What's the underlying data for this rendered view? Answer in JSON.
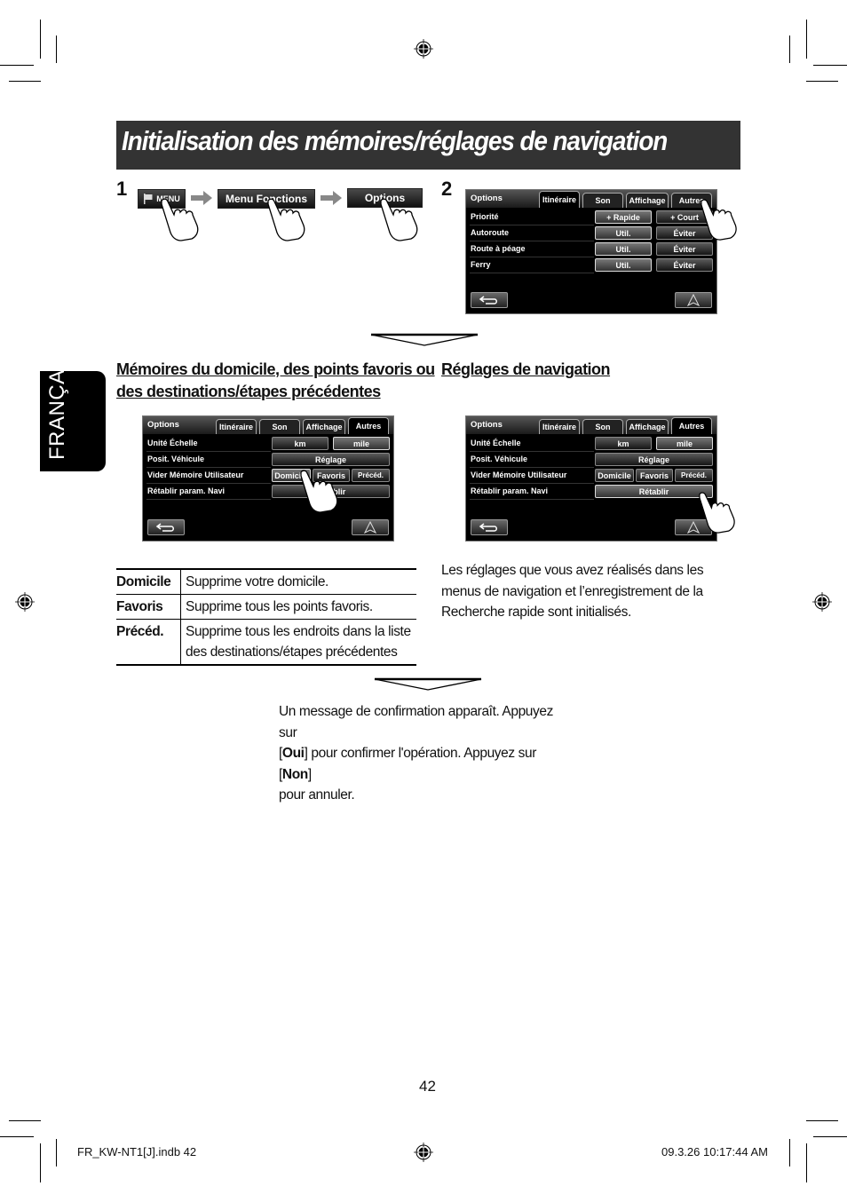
{
  "page": {
    "title": "Initialisation des mémoires/réglages de navigation",
    "page_number": "42",
    "language_tab": "FRANÇAIS"
  },
  "step1": {
    "number": "1",
    "buttons": [
      {
        "label": "MENU",
        "icon": "flag-icon"
      },
      {
        "label": "Menu Fonctions"
      },
      {
        "label": "Options"
      }
    ]
  },
  "step2": {
    "number": "2",
    "screen": {
      "title": "Options",
      "tabs": [
        "Itinéraire",
        "Son",
        "Affichage",
        "Autres"
      ],
      "active_tab": "Itinéraire",
      "rows": [
        {
          "label": "Priorité",
          "options": [
            "+ Rapide",
            "+ Court"
          ],
          "selected": "+ Rapide"
        },
        {
          "label": "Autoroute",
          "options": [
            "Util.",
            "Éviter"
          ],
          "selected": "Util."
        },
        {
          "label": "Route à péage",
          "options": [
            "Util.",
            "Éviter"
          ],
          "selected": "Util."
        },
        {
          "label": "Ferry",
          "options": [
            "Util.",
            "Éviter"
          ],
          "selected": "Util."
        }
      ]
    }
  },
  "memories": {
    "heading_line1": "Mémoires du domicile, des points favoris ou",
    "heading_line2": "des destinations/étapes précédentes",
    "screen": {
      "title": "Options",
      "tabs": [
        "Itinéraire",
        "Son",
        "Affichage",
        "Autres"
      ],
      "active_tab": "Autres",
      "rows": [
        {
          "label": "Unité Échelle",
          "options": [
            "km",
            "mile"
          ],
          "selected": "mile"
        },
        {
          "label": "Posit. Véhicule",
          "options": [
            "Réglage"
          ]
        },
        {
          "label": "Vider Mémoire Utilisateur",
          "options": [
            "Domicile",
            "Favoris",
            "Précéd."
          ]
        },
        {
          "label": "Rétablir param. Navi",
          "options": [
            "Rétablir"
          ]
        }
      ]
    },
    "table": [
      {
        "term": "Domicile",
        "description": "Supprime votre domicile."
      },
      {
        "term": "Favoris",
        "description": "Supprime tous les points favoris."
      },
      {
        "term": "Précéd.",
        "description": "Supprime tous les endroits dans la liste des destinations/étapes précédentes"
      }
    ]
  },
  "navigation": {
    "heading": "Réglages de navigation",
    "screen": {
      "title": "Options",
      "tabs": [
        "Itinéraire",
        "Son",
        "Affichage",
        "Autres"
      ],
      "active_tab": "Autres",
      "rows": [
        {
          "label": "Unité Échelle",
          "options": [
            "km",
            "mile"
          ],
          "selected": "mile"
        },
        {
          "label": "Posit. Véhicule",
          "options": [
            "Réglage"
          ]
        },
        {
          "label": "Vider Mémoire Utilisateur",
          "options": [
            "Domicile",
            "Favoris",
            "Précéd."
          ]
        },
        {
          "label": "Rétablir param. Navi",
          "options": [
            "Rétablir"
          ]
        }
      ]
    },
    "description": "Les réglages que vous avez réalisés dans les menus de navigation et l’enregistrement de la Recherche rapide sont initialisés."
  },
  "confirmation": {
    "line1": "Un message de confirmation apparaît. Appuyez sur",
    "open_bracket": "[",
    "oui": "Oui",
    "mid_text": "] pour confirmer l'opération. Appuyez sur [",
    "non": "Non",
    "close_bracket": "]",
    "line3": "pour annuler."
  },
  "footer": {
    "file": "FR_KW-NT1[J].indb   42",
    "timestamp": "09.3.26   10:17:44 AM"
  }
}
